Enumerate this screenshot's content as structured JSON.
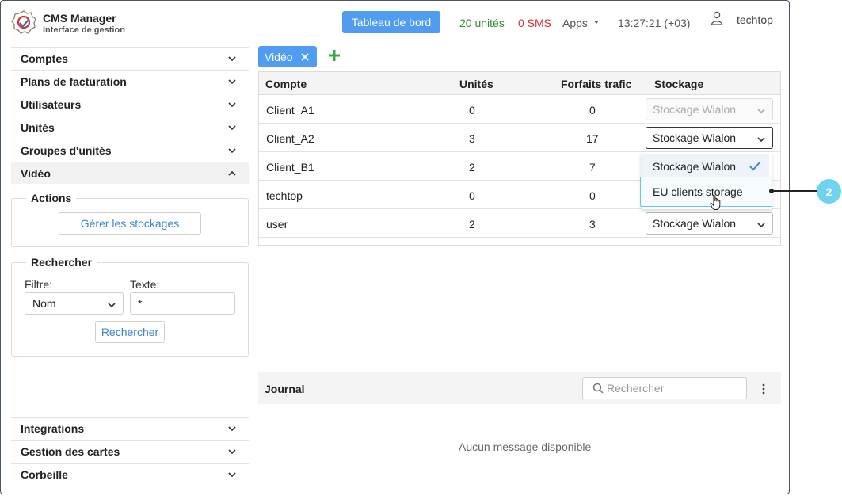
{
  "header": {
    "app_name": "CMS Manager",
    "app_subtitle": "Interface de gestion",
    "dashboard_button": "Tableau de bord",
    "units_count": "20 unités",
    "sms_count": "0 SMS",
    "apps_label": "Apps",
    "clock": "13:27:21 (+03)",
    "username": "techtop"
  },
  "sidebar": {
    "top_items": [
      {
        "label": "Comptes"
      },
      {
        "label": "Plans de facturation"
      },
      {
        "label": "Utilisateurs"
      },
      {
        "label": "Unités"
      },
      {
        "label": "Groupes d'unités"
      },
      {
        "label": "Vidéo"
      }
    ],
    "actions": {
      "legend": "Actions",
      "manage_button": "Gérer les stockages"
    },
    "search": {
      "legend": "Rechercher",
      "filter_label": "Filtre:",
      "filter_value": "Nom",
      "text_label": "Texte:",
      "text_value": "*",
      "search_button": "Rechercher"
    },
    "bottom_items": [
      {
        "label": "Integrations"
      },
      {
        "label": "Gestion des cartes"
      },
      {
        "label": "Corbeille"
      }
    ]
  },
  "tabs": [
    {
      "label": "Vidéo"
    }
  ],
  "table": {
    "columns": [
      "Compte",
      "Unités",
      "Forfaits trafic",
      "Stockage"
    ],
    "rows": [
      {
        "account": "Client_A1",
        "units": "0",
        "traffic": "0",
        "storage": "Stockage Wialon"
      },
      {
        "account": "Client_A2",
        "units": "3",
        "traffic": "17",
        "storage": "Stockage Wialon"
      },
      {
        "account": "Client_B1",
        "units": "2",
        "traffic": "7",
        "storage": ""
      },
      {
        "account": "techtop",
        "units": "0",
        "traffic": "0",
        "storage": ""
      },
      {
        "account": "user",
        "units": "2",
        "traffic": "3",
        "storage": "Stockage Wialon"
      }
    ]
  },
  "dropdown": {
    "options": [
      "Stockage Wialon",
      "EU clients storage"
    ]
  },
  "callout": {
    "number": "2"
  },
  "journal": {
    "title": "Journal",
    "search_placeholder": "Rechercher",
    "empty_message": "Aucun message disponible"
  },
  "colors": {
    "accent": "#4f9cf0",
    "units_green": "#2e8b2e",
    "sms_red": "#d32f2f",
    "callout": "#6fd3ef"
  }
}
